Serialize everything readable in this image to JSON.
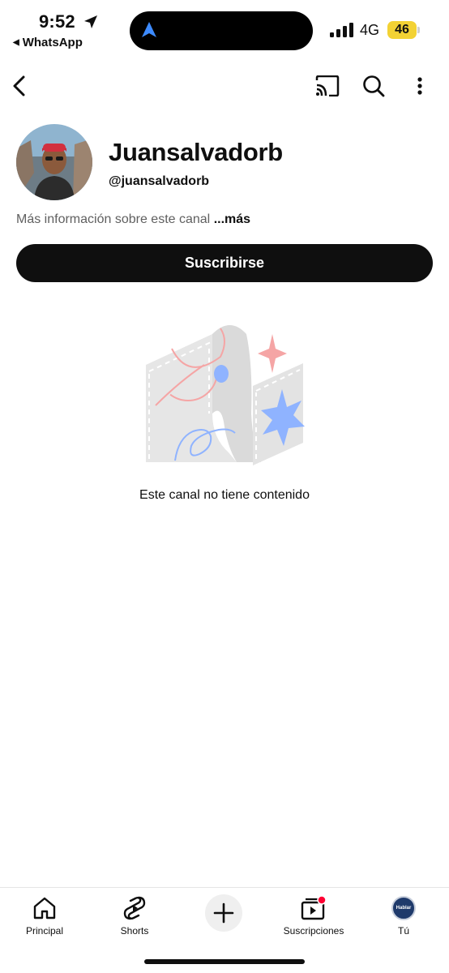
{
  "status_bar": {
    "time": "9:52",
    "back_app": "WhatsApp",
    "network": "4G",
    "battery": "46"
  },
  "app_bar": {
    "icons": [
      "back-arrow-icon",
      "cast-icon",
      "search-icon",
      "more-vert-icon"
    ]
  },
  "channel": {
    "name": "Juansalvadorb",
    "handle": "@juansalvadorb",
    "more_info_text": "Más información sobre este canal",
    "more_info_link": "...más",
    "subscribe_label": "Suscribirse"
  },
  "empty_state": {
    "message": "Este canal no tiene contenido"
  },
  "bottom_nav": {
    "items": [
      {
        "label": "Principal",
        "icon": "home-icon"
      },
      {
        "label": "Shorts",
        "icon": "shorts-icon"
      },
      {
        "label": "",
        "icon": "create-plus-icon"
      },
      {
        "label": "Suscripciones",
        "icon": "subscriptions-icon"
      },
      {
        "label": "Tú",
        "icon": "profile-avatar"
      }
    ],
    "avatar_text": "Hablar"
  },
  "colors": {
    "accent_red": "#ff0033",
    "dark": "#0f0f0f",
    "battery": "#f3d234",
    "illustration_blue": "#8fb3ff",
    "illustration_pink": "#f5a5a5"
  }
}
